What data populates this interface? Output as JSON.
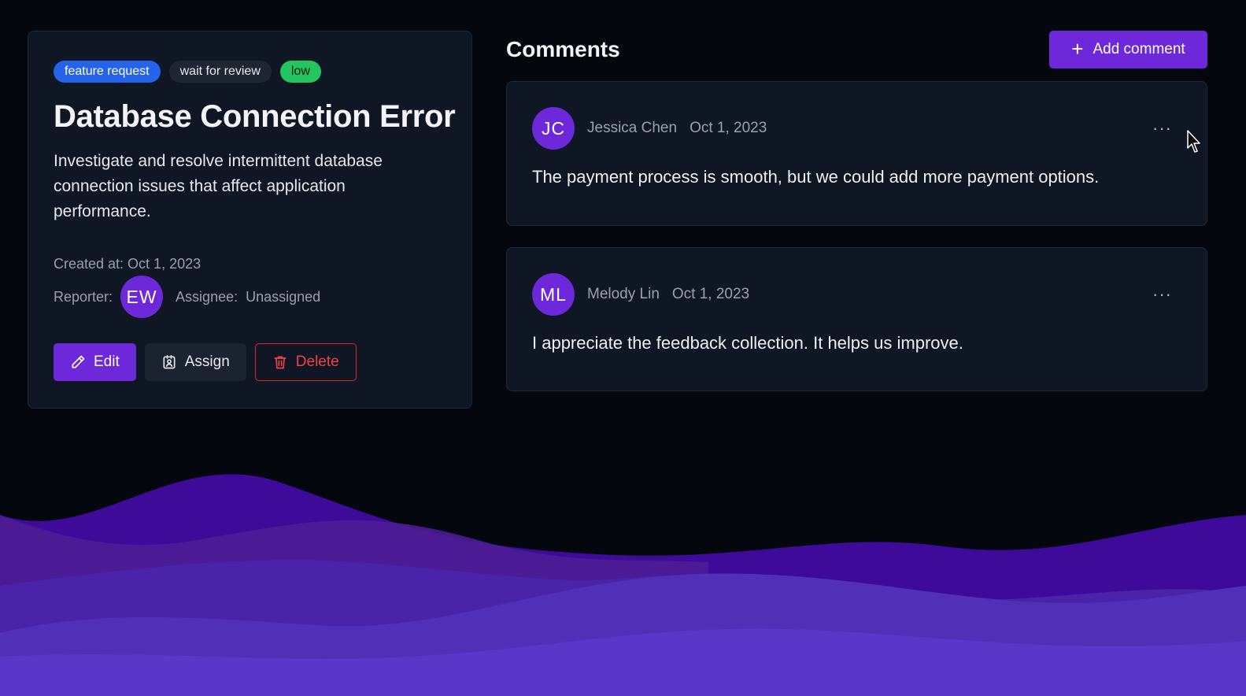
{
  "ticket": {
    "tags": [
      {
        "label": "feature request",
        "color": "#2563eb"
      },
      {
        "label": "wait for review",
        "color": "#1f2633"
      },
      {
        "label": "low",
        "color": "#22c55e"
      }
    ],
    "title": "Database Connection Error",
    "description": "Investigate and resolve intermittent database connection issues that affect application performance.",
    "created_at": "Created at: Oct 1, 2023",
    "reporter_label": "Reporter:",
    "reporter_initials": "EW",
    "assignee_label": "Assignee:",
    "assignee_value": "Unassigned",
    "actions": {
      "edit": "Edit",
      "assign": "Assign",
      "delete": "Delete"
    }
  },
  "comments_section": {
    "title": "Comments",
    "add_button": "Add comment",
    "items": [
      {
        "initials": "JC",
        "author": "Jessica Chen",
        "date": "Oct 1, 2023",
        "text": "The payment process is smooth, but we could add more payment options."
      },
      {
        "initials": "ML",
        "author": "Melody Lin",
        "date": "Oct 1, 2023",
        "text": "I appreciate the feedback collection. It helps us improve."
      }
    ]
  },
  "colors": {
    "accent": "#6d28d9",
    "danger": "#dc2626",
    "background": "#05070e",
    "card": "#0f1624"
  }
}
